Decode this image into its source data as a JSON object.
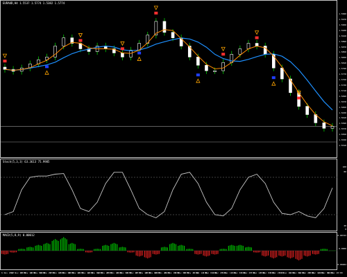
{
  "main": {
    "title": "EURAUD,H4 1.5537 1.5774 1.5382 1.5774",
    "price_ticks": [
      "1.5990",
      "1.5970",
      "1.5950",
      "1.5930",
      "1.5910",
      "1.5890",
      "1.5870",
      "1.5850",
      "1.5830",
      "1.5810",
      "1.5790",
      "1.5770",
      "1.5750",
      "1.5730",
      "1.5710",
      "1.5690",
      "1.5670",
      "1.5650",
      "1.5630",
      "1.5610",
      "1.5590",
      "1.5570",
      "1.5550",
      "1.5530",
      "1.5510"
    ],
    "current_price": "1.5577",
    "colors": {
      "candle_body": "#ffffff",
      "wick": "#00cc00",
      "ma_fast": "#ff8c00",
      "ma_slow": "#1e90ff",
      "sell_marker": "#ff3030",
      "buy_marker": "#2040ff",
      "arrow": "#ffa500"
    }
  },
  "stoch": {
    "title": "Stoch(5,3,3) 63.3613 75.9985",
    "ticks": [
      "100",
      "80",
      "20",
      "0"
    ],
    "colors": {
      "line": "#c8c8c8",
      "level": "#808080"
    }
  },
  "macd": {
    "title": "MACD(5,8,9) 0.00012",
    "ticks": [
      "0.00743",
      "0.0000",
      "-0.00482"
    ],
    "colors": {
      "positive": "#00c000",
      "negative": "#e02020"
    }
  },
  "time_labels": [
    "6 Nov 2017",
    "14 Nov 20:00",
    "15 Nov 12:00",
    "16 Nov 04:00",
    "16 Nov 20:00",
    "17 Nov 12:00",
    "20 Nov 04:00",
    "20 Nov 20:00",
    "21 Nov 12:00",
    "22 Nov 04:00",
    "22 Nov 20:00",
    "23 Nov 12:00",
    "24 Nov 04:00",
    "24 Nov 20:00",
    "27 Nov 12:00",
    "28 Nov 04:00",
    "28 Nov 20:00",
    "29 Nov 12:00",
    "30 Nov 04:00",
    "30 Nov 20:00",
    "1 Dec 12:00",
    "4 Dec 04:00",
    "4 Dec 20:00",
    "5 Dec 12:00",
    "6 Dec 04:00",
    "6 Dec 20:00",
    "7 Dec 12:00",
    "8 Dec 04:00",
    "8 Dec 20:00",
    "11 Dec 12:00",
    "12 Dec 04:00",
    "12 Dec 20:00",
    "13 Dec 12:00",
    "14 Dec 04:00",
    "14 Dec 20:00"
  ],
  "chart_data": {
    "type": "candlestick-with-indicators",
    "series": [
      {
        "name": "price",
        "values": [
          1.5785,
          1.5778,
          1.579,
          1.5805,
          1.582,
          1.583,
          1.587,
          1.59,
          1.588,
          1.586,
          1.585,
          1.587,
          1.586,
          1.5845,
          1.583,
          1.5855,
          1.588,
          1.591,
          1.596,
          1.592,
          1.59,
          1.587,
          1.583,
          1.58,
          1.578,
          1.578,
          1.581,
          1.584,
          1.586,
          1.588,
          1.587,
          1.584,
          1.579,
          1.575,
          1.57,
          1.565,
          1.562,
          1.559,
          1.557,
          1.5577
        ]
      },
      {
        "name": "stochastic",
        "values": [
          20,
          25,
          60,
          80,
          82,
          82,
          85,
          86,
          60,
          30,
          25,
          40,
          70,
          88,
          88,
          60,
          30,
          20,
          15,
          25,
          60,
          85,
          88,
          70,
          40,
          20,
          18,
          30,
          60,
          80,
          85,
          70,
          40,
          22,
          20,
          25,
          18,
          15,
          30,
          63
        ]
      },
      {
        "name": "macd",
        "values": [
          -0.002,
          -0.001,
          0.001,
          0.002,
          0.003,
          0.004,
          0.006,
          0.007,
          0.004,
          0.001,
          -0.001,
          0.001,
          0.003,
          0.004,
          0.002,
          -0.001,
          -0.003,
          -0.004,
          -0.002,
          0.002,
          0.004,
          0.003,
          0.001,
          -0.002,
          -0.003,
          -0.002,
          0.001,
          0.003,
          0.003,
          0.002,
          -0.001,
          -0.003,
          -0.004,
          -0.003,
          -0.004,
          -0.005,
          -0.003,
          -0.002,
          0.001,
          0.0001
        ]
      }
    ]
  }
}
